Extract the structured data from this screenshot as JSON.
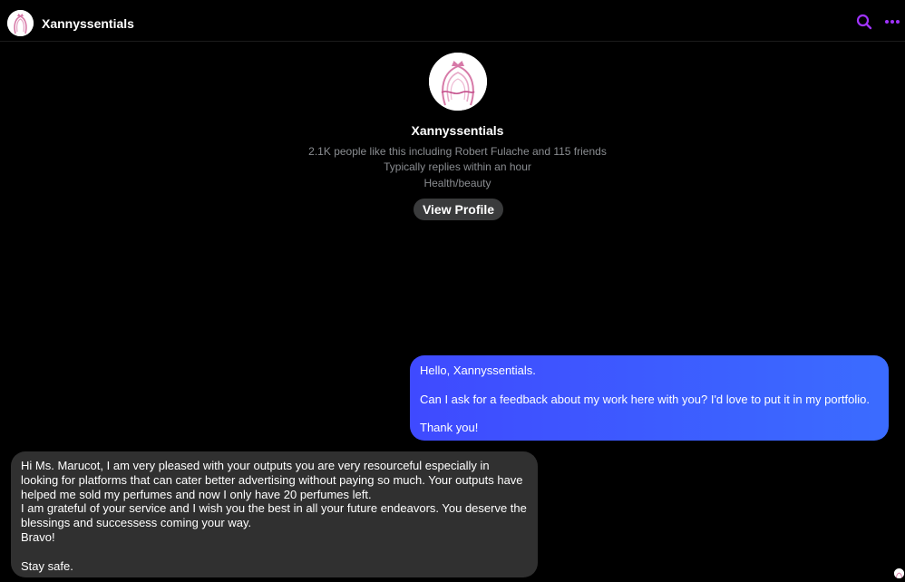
{
  "header": {
    "title": "Xannyssentials",
    "icons": [
      "search-icon",
      "more-icon"
    ],
    "accent": "#a033ff"
  },
  "profile": {
    "name": "Xannyssentials",
    "likes_line": "2.1K people like this including Robert Fulache and 115 friends",
    "reply_time": "Typically replies within an hour",
    "category": "Health/beauty",
    "view_profile_label": "View Profile"
  },
  "messages": {
    "outgoing": {
      "line1": "Hello, Xannyssentials.",
      "line2": "Can I ask for a feedback about my work here with you? I'd love to put it in my portfolio.",
      "line3": "Thank you!",
      "color": "#3b5bff"
    },
    "incoming": {
      "text": "Hi Ms.  Marucot,  I am very pleased with your outputs you are very resourceful especially in looking for platforms that can cater better advertising  without paying so much.  Your outputs have helped me sold my perfumes  and now I only have 20 perfumes left.\nI am grateful of your service and I wish you the best in all your future endeavors. You deserve the blessings and successess coming your way.\nBravo!\n\nStay safe.",
      "color": "#303030"
    }
  }
}
